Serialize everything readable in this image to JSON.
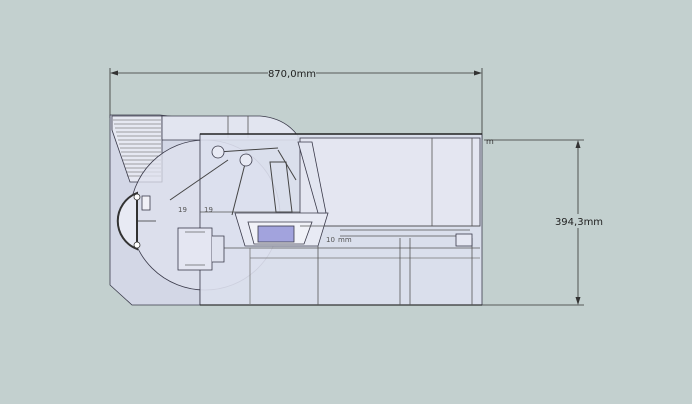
{
  "dimensions": {
    "width_label": "870,0mm",
    "height_label": "394,3mm",
    "top_right_tag": "m"
  },
  "annotations": {
    "small_left_a": "19",
    "small_left_b": "19",
    "small_center": "10",
    "small_center_b": "mm"
  },
  "colors": {
    "background": "#c3d0cf",
    "model_fill": "#d9dcec",
    "model_stroke": "#3a3a4a",
    "dim_line": "#333333",
    "highlight": "#8f8fd6"
  }
}
